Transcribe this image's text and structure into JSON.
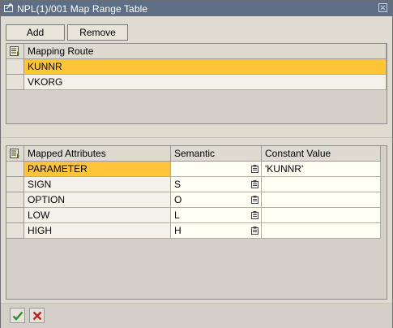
{
  "window": {
    "title": "NPL(1)/001 Map Range Table"
  },
  "toolbar": {
    "add_label": "Add",
    "remove_label": "Remove"
  },
  "route_table": {
    "header": "Mapping Route",
    "rows": [
      "KUNNR",
      "VKORG"
    ]
  },
  "attr_table": {
    "headers": {
      "attribute": "Mapped Attributes",
      "semantic": "Semantic",
      "constant": "Constant Value"
    },
    "rows": [
      {
        "attribute": "PARAMETER",
        "semantic": "",
        "constant": "'KUNNR'"
      },
      {
        "attribute": "SIGN",
        "semantic": "S",
        "constant": ""
      },
      {
        "attribute": "OPTION",
        "semantic": "O",
        "constant": ""
      },
      {
        "attribute": "LOW",
        "semantic": "L",
        "constant": ""
      },
      {
        "attribute": "HIGH",
        "semantic": "H",
        "constant": ""
      }
    ]
  },
  "colors": {
    "titlebar": "#5d6e86",
    "selected_row": "#fec53a",
    "confirm": "#2e8b2e",
    "cancel": "#c41e1e"
  },
  "icons": {
    "title": "window-icon",
    "close": "close-icon",
    "config": "table-config-icon",
    "value_help": "value-help-icon",
    "confirm": "checkmark-icon",
    "cancel": "cancel-icon"
  }
}
